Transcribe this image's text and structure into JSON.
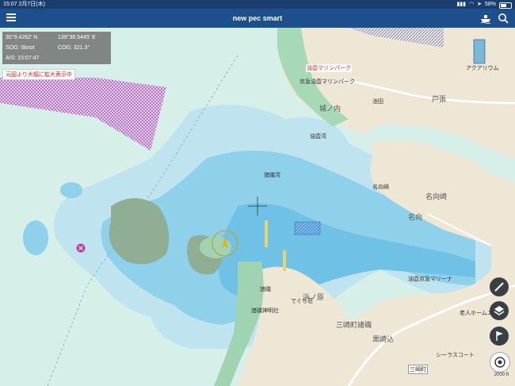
{
  "status": {
    "time": "15:07",
    "date": "2月7日(木)",
    "battery": "58%",
    "battery_level": 0.58
  },
  "header": {
    "title": "new pec smart"
  },
  "info": {
    "latitude": "35°9.4262' N",
    "longitude": "139°36.5445' E",
    "sog": "SOG: 0knot",
    "cog": "COG: 321.3°",
    "ais": "AIS: 15:07:47"
  },
  "notice": "元図より大幅に拡大表示中",
  "scale": "2000 ft",
  "places": {
    "yusen_marina": "油壺マリンパーク",
    "yusen_marina2": "京急油壺マリンパーク",
    "jonouchi": "城ノ内",
    "todo": "戸張",
    "aburatsubo_bay": "油壺湾",
    "moroiso_bay": "諸磯湾",
    "nakagawa": "名向崎",
    "namuki": "名向",
    "moroiso": "諸磯",
    "moroiso_shrine": "諸磯神明社",
    "hamanohara": "浜ノ原",
    "misaki_moroiso": "三崎町諸磯",
    "kurozaki": "黒崎込",
    "shirasu_court": "シーラスコート",
    "aburatsubo_marina": "油壺京急マリーナ",
    "aquarium": "アクアリウム",
    "deguchi": "でぐち荘",
    "misaki_town": "三崎町",
    "elderly_home": "老人ホームエ…",
    "namuki_cape": "名向崎",
    "ikecho": "池田"
  }
}
